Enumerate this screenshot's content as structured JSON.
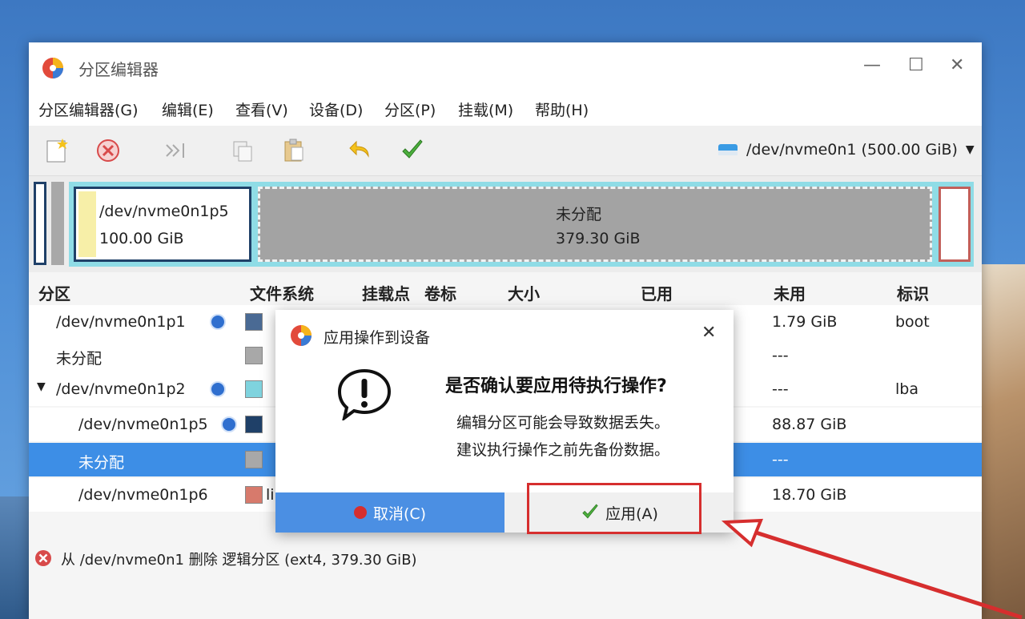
{
  "window": {
    "title": "分区编辑器",
    "minimize": "—",
    "maximize": "☐",
    "close": "✕"
  },
  "menu": [
    {
      "label": "分区编辑器(G)"
    },
    {
      "label": "编辑(E)"
    },
    {
      "label": "查看(V)"
    },
    {
      "label": "设备(D)"
    },
    {
      "label": "分区(P)"
    },
    {
      "label": "挂载(M)"
    },
    {
      "label": "帮助(H)"
    }
  ],
  "toolbar": {
    "icons": [
      "new-icon",
      "delete-icon",
      "resize-move-icon",
      "copy-icon",
      "paste-icon",
      "undo-icon",
      "apply-check-icon"
    ],
    "device": "/dev/nvme0n1 (500.00 GiB)"
  },
  "diskmap": {
    "p5": {
      "name": "/dev/nvme0n1p5",
      "size": "100.00 GiB"
    },
    "unalloc": {
      "name": "未分配",
      "size": "379.30 GiB"
    }
  },
  "columns": [
    "分区",
    "文件系统",
    "挂载点",
    "卷标",
    "大小",
    "已用",
    "未用",
    "标识"
  ],
  "rows": [
    {
      "partition": "/dev/nvme0n1p1",
      "fs": "",
      "unused": "1.79 GiB",
      "flags": "boot",
      "color": "#4a6a94"
    },
    {
      "partition": "未分配",
      "fs": "",
      "unused": "---",
      "flags": "",
      "color": "#a8a8a8"
    },
    {
      "partition": "/dev/nvme0n1p2",
      "fs": "",
      "unused": "---",
      "flags": "lba",
      "color": "#7fd3de"
    },
    {
      "partition": "/dev/nvme0n1p5",
      "fs": "",
      "unused": "88.87 GiB",
      "flags": "",
      "color": "#1f4068"
    },
    {
      "partition": "未分配",
      "fs": "",
      "unused": "---",
      "flags": "",
      "color": "#a8a8a8"
    },
    {
      "partition": "/dev/nvme0n1p6",
      "fs": "li",
      "unused": "18.70 GiB",
      "flags": "",
      "color": "#d77a6c"
    }
  ],
  "status": {
    "text": "从 /dev/nvme0n1 删除 逻辑分区 (ext4, 379.30 GiB)"
  },
  "dialog": {
    "title": "应用操作到设备",
    "heading": "是否确认要应用待执行操作?",
    "line1": "编辑分区可能会导致数据丢失。",
    "line2": "建议执行操作之前先备份数据。",
    "cancel_label": "取消(C)",
    "apply_label": "应用(A)"
  },
  "colors": {
    "selection": "#3d8ee6",
    "highlight": "#d62e2e",
    "cancel_button": "#4b8fe3"
  }
}
